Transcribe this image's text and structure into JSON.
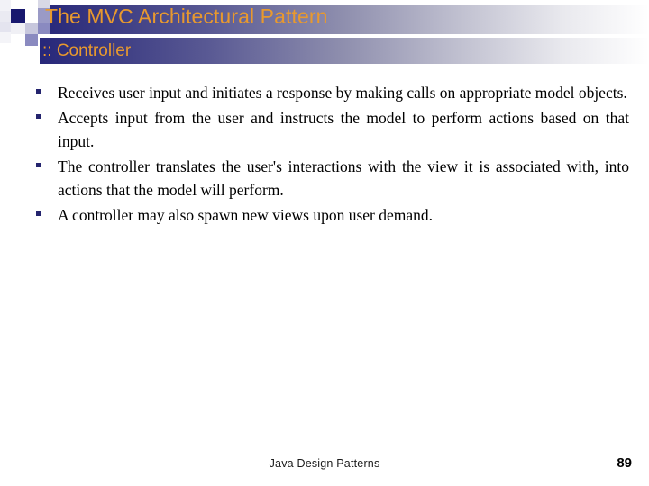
{
  "slide": {
    "title": "The MVC Architectural Pattern",
    "subtitle": ":: Controller",
    "bullets": [
      {
        "text": "Receives user input and initiates a response by making calls on appropriate model objects."
      },
      {
        "text": "Accepts input from the user and instructs the model to perform actions based on that input."
      },
      {
        "text": "The controller translates the user's interactions with the view it is associated with, into actions that the model will perform."
      },
      {
        "text": "A controller may also spawn new views upon user demand."
      }
    ],
    "footer": {
      "label": "Java Design Patterns",
      "page_number": "89"
    },
    "colors": {
      "title_text": "#e8992e",
      "band_start": "#27277a",
      "band_end": "#ffffff",
      "bullet_marker": "#24246e",
      "body_text": "#000000",
      "deco_dark": "#18186e",
      "deco_mid": "#8a8ac0",
      "deco_light": "#c7c7dd",
      "deco_pale": "#e4e4ef"
    }
  }
}
